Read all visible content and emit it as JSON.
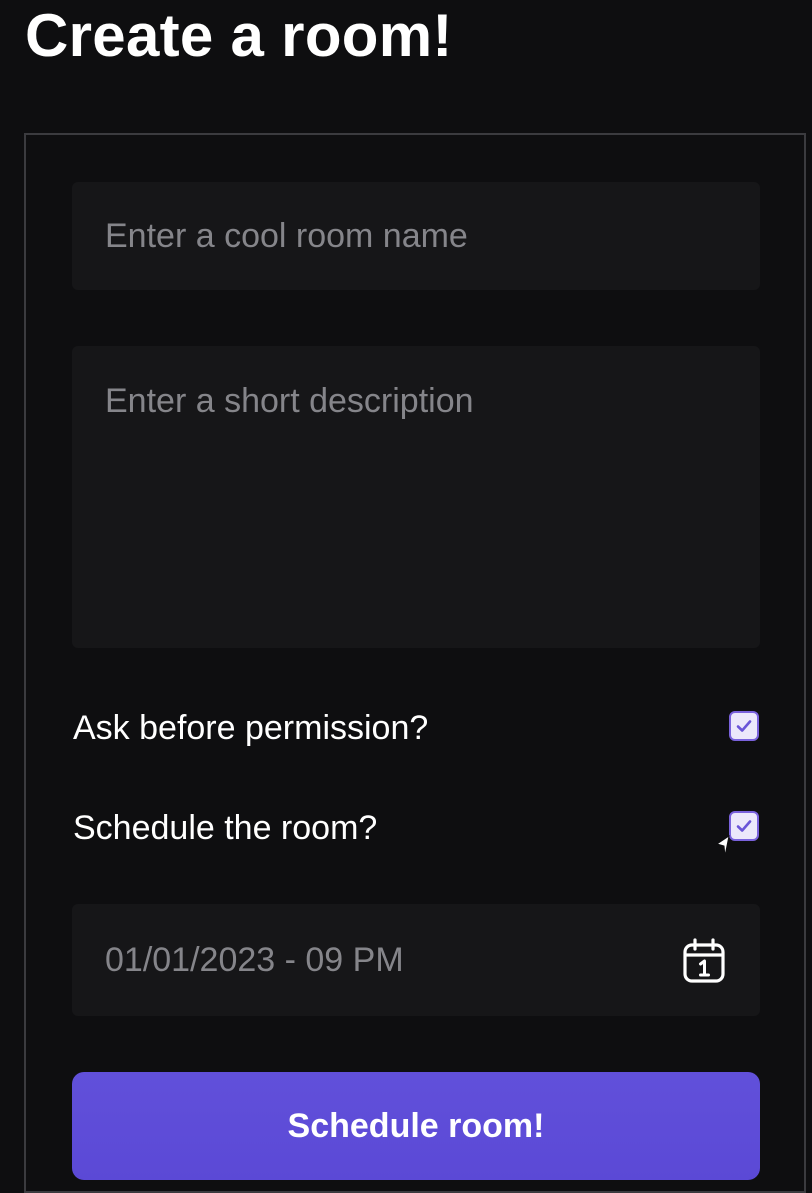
{
  "page": {
    "title": "Create a room!"
  },
  "form": {
    "room_name": {
      "placeholder": "Enter a cool room name",
      "value": ""
    },
    "description": {
      "placeholder": "Enter a short description",
      "value": ""
    },
    "ask_permission": {
      "label": "Ask before permission?",
      "checked": true
    },
    "schedule_room": {
      "label": "Schedule the room?",
      "checked": true
    },
    "datetime": {
      "value": "01/01/2023 - 09 PM",
      "icon": "calendar-icon"
    },
    "submit_label": "Schedule room!"
  },
  "colors": {
    "background": "#0e0e10",
    "field_background": "#161618",
    "accent": "#5d4ed8",
    "checkbox_border": "#7a62dc",
    "placeholder": "#85858a",
    "text": "#ffffff"
  }
}
